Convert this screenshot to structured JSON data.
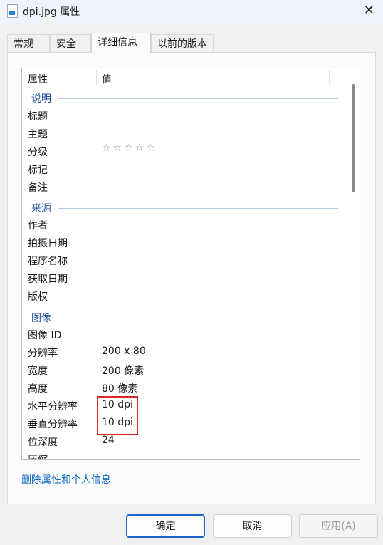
{
  "window": {
    "title": "dpi.jpg 属性",
    "close_glyph": "✕"
  },
  "tabs": [
    "常规",
    "安全",
    "详细信息",
    "以前的版本"
  ],
  "columns": {
    "property": "属性",
    "value": "值"
  },
  "groups": {
    "description": "说明",
    "origin": "来源",
    "image": "图像"
  },
  "rows": {
    "title": {
      "k": "标题",
      "v": ""
    },
    "subject": {
      "k": "主题",
      "v": ""
    },
    "rating": {
      "k": "分级",
      "v": "☆☆☆☆☆"
    },
    "tags": {
      "k": "标记",
      "v": ""
    },
    "comments": {
      "k": "备注",
      "v": ""
    },
    "authors": {
      "k": "作者",
      "v": ""
    },
    "date_taken": {
      "k": "拍摄日期",
      "v": ""
    },
    "program": {
      "k": "程序名称",
      "v": ""
    },
    "date_acquired": {
      "k": "获取日期",
      "v": ""
    },
    "copyright": {
      "k": "版权",
      "v": ""
    },
    "image_id": {
      "k": "图像 ID",
      "v": ""
    },
    "dimensions": {
      "k": "分辨率",
      "v": "200 x 80"
    },
    "width": {
      "k": "宽度",
      "v": "200 像素"
    },
    "height": {
      "k": "高度",
      "v": "80 像素"
    },
    "h_res": {
      "k": "水平分辨率",
      "v": "10 dpi"
    },
    "v_res": {
      "k": "垂直分辨率",
      "v": "10 dpi"
    },
    "bit_depth": {
      "k": "位深度",
      "v": "24"
    },
    "compression": {
      "k": "压缩",
      "v": ""
    }
  },
  "link": "删除属性和个人信息",
  "buttons": {
    "ok": "确定",
    "cancel": "取消",
    "apply": "应用(A)"
  },
  "colors": {
    "highlight_box": "#e0242b",
    "group_text": "#1f4e9e",
    "link": "#0b67c2"
  }
}
